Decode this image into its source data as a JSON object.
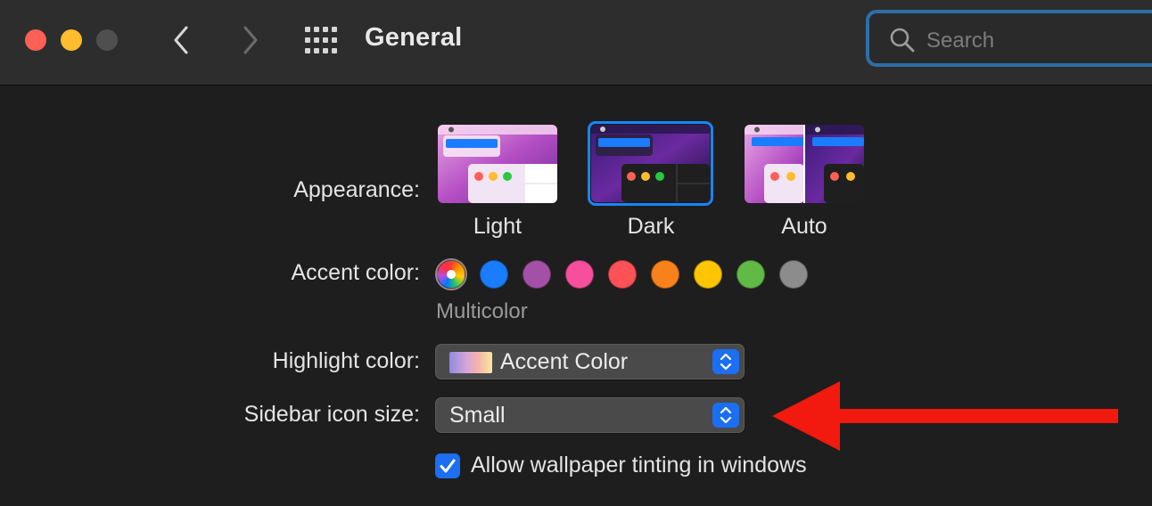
{
  "window": {
    "title": "General",
    "search_placeholder": "Search"
  },
  "icons": {
    "back": "chevron-left-icon",
    "forward": "chevron-right-icon",
    "grid": "grid-icon",
    "search": "magnifier-icon",
    "stepper": "up-down-chevron-icon",
    "check": "checkmark-icon",
    "annotation": "red-arrow"
  },
  "appearance": {
    "label": "Appearance:",
    "options": [
      {
        "name": "Light",
        "selected": false
      },
      {
        "name": "Dark",
        "selected": true
      },
      {
        "name": "Auto",
        "selected": false
      }
    ]
  },
  "accent": {
    "label": "Accent color:",
    "selected_caption": "Multicolor",
    "colors": [
      {
        "name": "multicolor",
        "hex": "multicolor",
        "selected": true
      },
      {
        "name": "blue",
        "hex": "#1a7cff"
      },
      {
        "name": "purple",
        "hex": "#a550a7"
      },
      {
        "name": "pink",
        "hex": "#f74f9e"
      },
      {
        "name": "red",
        "hex": "#ff5257"
      },
      {
        "name": "orange",
        "hex": "#f7821b"
      },
      {
        "name": "yellow",
        "hex": "#ffc600"
      },
      {
        "name": "green",
        "hex": "#62ba46"
      },
      {
        "name": "graphite",
        "hex": "#8c8c8c"
      }
    ]
  },
  "highlight": {
    "label": "Highlight color:",
    "value": "Accent Color"
  },
  "sidebar_icon_size": {
    "label": "Sidebar icon size:",
    "value": "Small"
  },
  "wallpaper_tinting": {
    "label": "Allow wallpaper tinting in windows",
    "checked": true
  },
  "colors": {
    "accent_blue": "#1c6ef2",
    "annotation_red": "#f2190e"
  }
}
